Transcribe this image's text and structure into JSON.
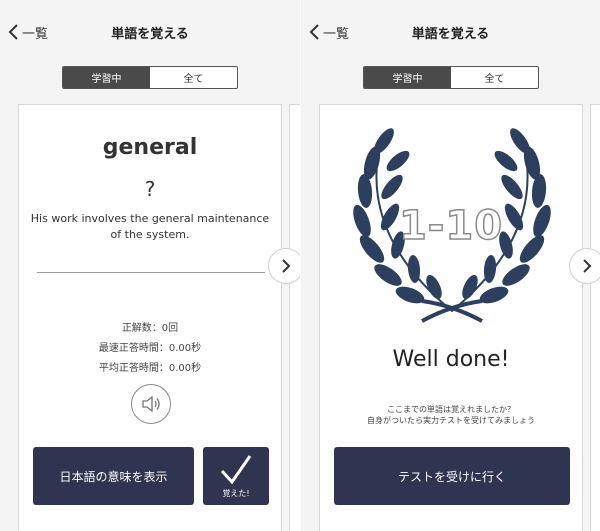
{
  "left": {
    "nav": {
      "back_label": "一覧",
      "title": "単語を覚える"
    },
    "tabs": [
      "学習中",
      "全て"
    ],
    "card": {
      "word": "general",
      "reading": "?",
      "example": "His work involves the general maintenance of the system.",
      "stats": [
        {
          "label": "正解数",
          "value": "0回"
        },
        {
          "label": "最速正答時間",
          "value": "0.00秒"
        },
        {
          "label": "平均正答時間",
          "value": "0.00秒"
        }
      ],
      "stats_text": [
        "正解数：0回",
        "最速正答時間：0.00秒",
        "平均正答時間：0.00秒"
      ],
      "meaning_button": "日本語の意味を表示",
      "learned_button": "覚えた!"
    }
  },
  "right": {
    "nav": {
      "back_label": "一覧",
      "title": "単語を覚える"
    },
    "tabs": [
      "学習中",
      "全て"
    ],
    "card": {
      "range": "1-10",
      "heading": "Well done!",
      "message_line1": "ここまでの単語は覚えれましたか？",
      "message_line2": "自身がついたら実力テストを受けてみましょう",
      "test_button": "テストを受けに行く"
    }
  },
  "colors": {
    "button_bg": "#2f3550",
    "laurel": "#2c3f5e",
    "segment_active": "#4a4a4a"
  },
  "icons": [
    "chevron-left-icon",
    "chevron-right-icon",
    "speaker-icon",
    "checkmark-icon",
    "laurel-wreath-icon"
  ]
}
